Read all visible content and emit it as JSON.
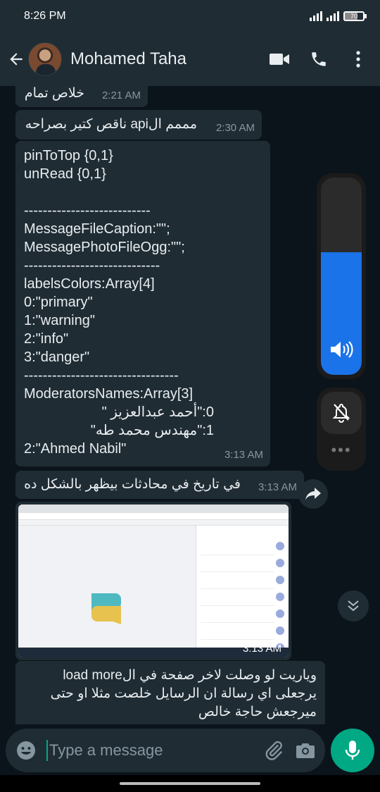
{
  "status_bar": {
    "time": "8:26 PM",
    "battery": "70"
  },
  "header": {
    "contact_name": "Mohamed Taha"
  },
  "messages": [
    {
      "text": "خلاص تمام",
      "time": "2:21 AM"
    },
    {
      "text": "مممم الapi ناقص كتير بصراحه",
      "time": "2:30 AM"
    },
    {
      "lines": [
        "pinToTop {0,1}",
        "unRead {0,1}",
        "",
        "---------------------------",
        "MessageFileCaption:\"\";",
        "MessagePhotoFileOgg:\"\";",
        "-----------------------------",
        "labelsColors:Array[4]",
        "0:\"primary\"",
        "1:\"warning\"",
        "2:\"info\"",
        "3:\"danger\"",
        "---------------------------------",
        "ModeratorsNames:Array[3]",
        "0:\"أحمد عبدالعزيز \"",
        "1:\"مهندس محمد طه\"",
        "2:\"Ahmed Nabil\""
      ],
      "time": "3:13 AM"
    },
    {
      "text": "في تاريخ في محادثات بيظهر بالشكل ده",
      "time": "3:13 AM"
    },
    {
      "image": "screenshot-of-chat-app",
      "time": "3:13 AM"
    },
    {
      "lines": [
        "وياريت لو وصلت لاخر صفحة في الload more",
        "يرجعلى اي رسالة ان الرسايل خلصت مثلا او حتى",
        "ميرجعش حاجة خالص"
      ]
    }
  ],
  "volume": {
    "level_percent": 62
  },
  "input": {
    "placeholder": "Type a message"
  },
  "colors": {
    "accent": "#00a884",
    "bubble": "#1f2c34",
    "background": "#0b141a",
    "volume_fill": "#1a73e8"
  }
}
